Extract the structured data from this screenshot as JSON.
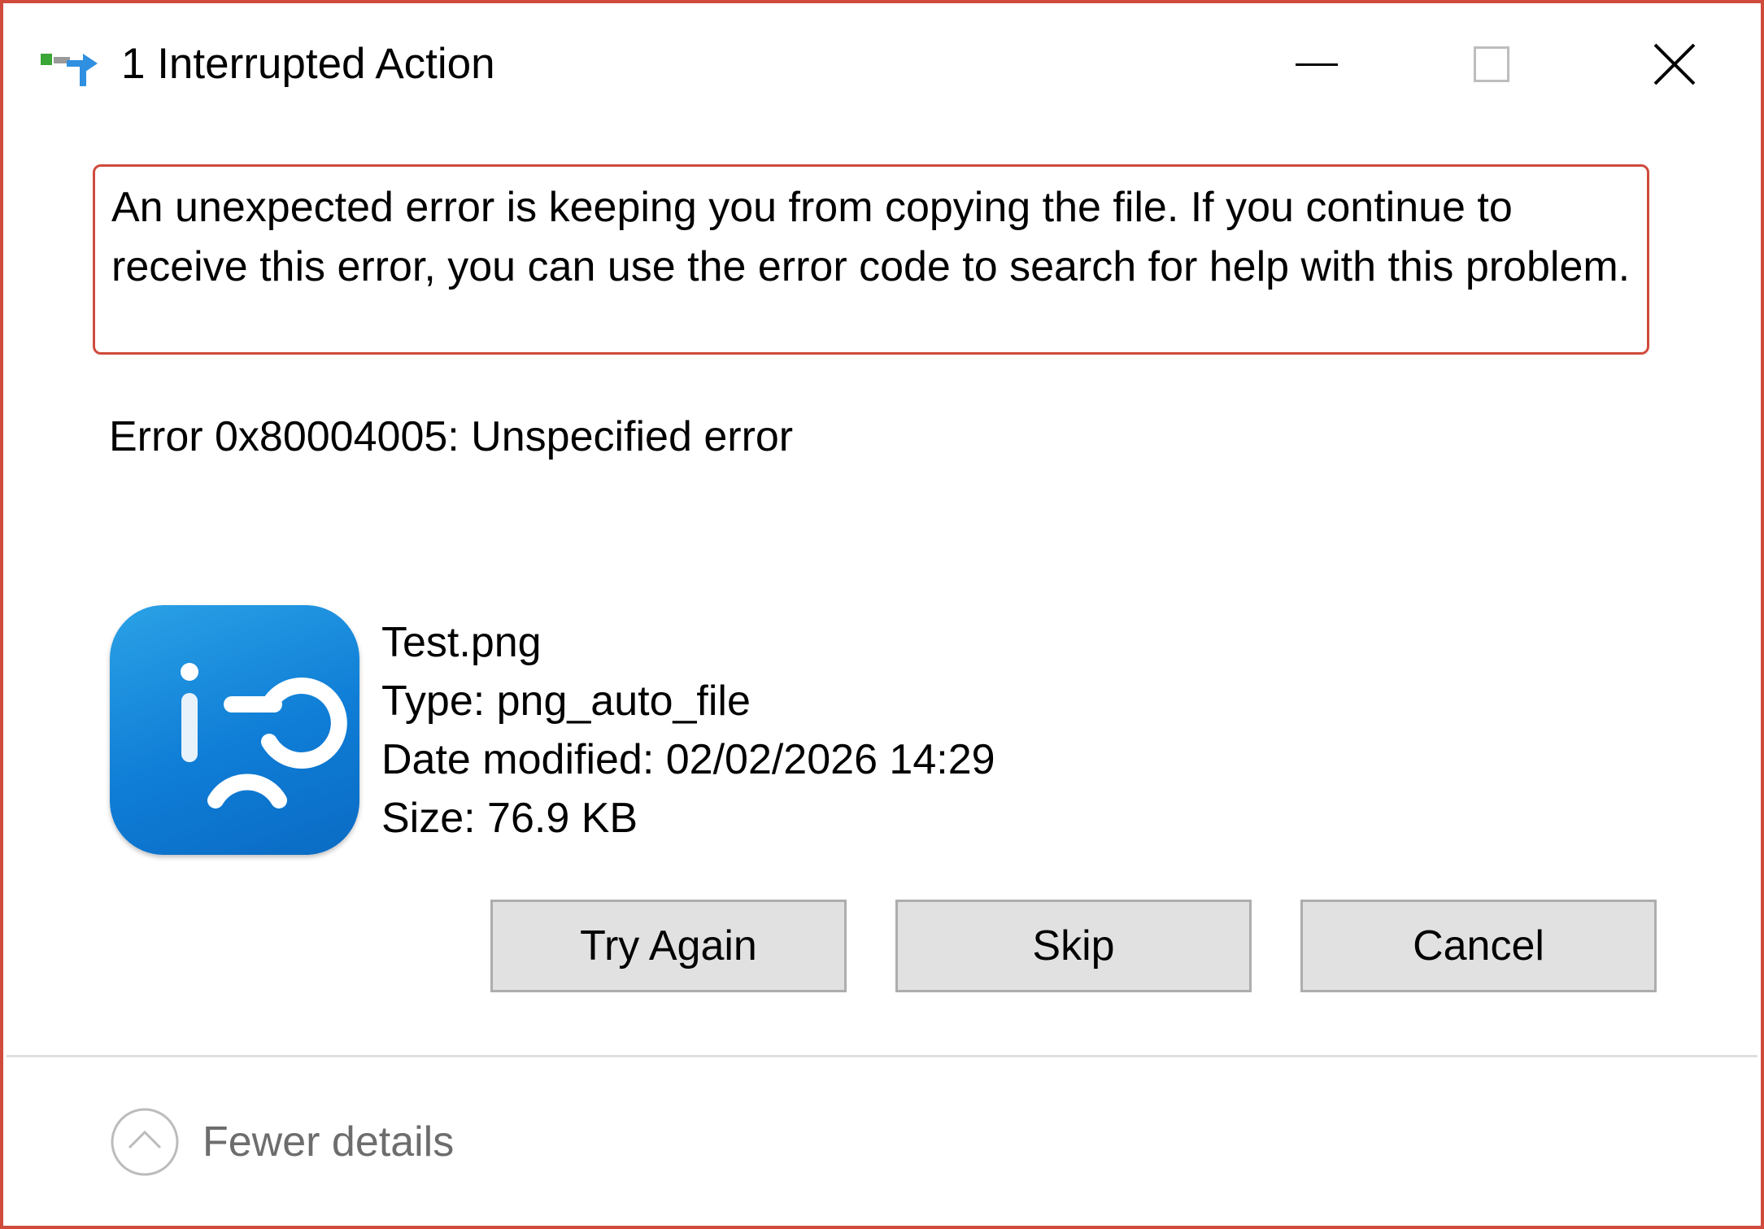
{
  "window": {
    "title": "1 Interrupted Action",
    "border_color": "#cf4b3c"
  },
  "title_bar": {
    "icon": "file-copy-icon",
    "minimize_icon": "minimize-icon",
    "maximize_icon": "maximize-icon",
    "close_icon": "close-icon"
  },
  "message": {
    "text": "An unexpected error is keeping you from copying the file. If you continue to receive this error, you can use the error code to search for help with this problem.",
    "highlight_color": "#cf4b3c"
  },
  "error": {
    "code_text": "Error 0x80004005: Unspecified error"
  },
  "file": {
    "icon": "image-glass-app-icon",
    "icon_color": "#0f7dd6",
    "name": "Test.png",
    "type": "Type: png_auto_file",
    "date_modified": "Date modified: 02/02/2026 14:29",
    "size": "Size: 76.9 KB"
  },
  "buttons": {
    "try_again": "Try Again",
    "skip": "Skip",
    "cancel": "Cancel"
  },
  "details": {
    "icon": "chevron-up-circle-icon",
    "label": "Fewer details"
  }
}
